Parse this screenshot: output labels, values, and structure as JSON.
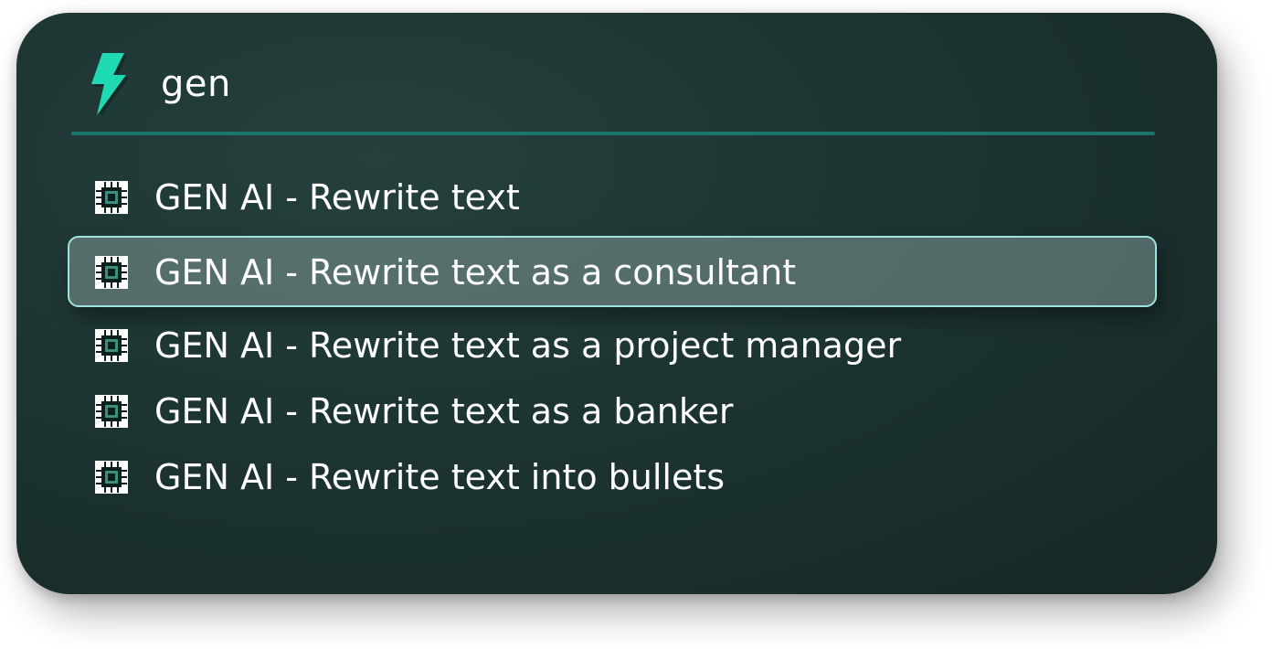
{
  "search": {
    "query": "gen",
    "icon": "lightning-bolt-icon",
    "accent_color": "#1fd9b3"
  },
  "results": [
    {
      "label": "GEN AI - Rewrite text",
      "icon": "chip-icon",
      "selected": false
    },
    {
      "label": "GEN AI - Rewrite text as a consultant",
      "icon": "chip-icon",
      "selected": true
    },
    {
      "label": "GEN AI - Rewrite text as a project manager",
      "icon": "chip-icon",
      "selected": false
    },
    {
      "label": "GEN AI - Rewrite text as a banker",
      "icon": "chip-icon",
      "selected": false
    },
    {
      "label": "GEN AI - Rewrite text into bullets",
      "icon": "chip-icon",
      "selected": false
    }
  ],
  "colors": {
    "panel_background": "#1c3432",
    "divider": "#1b7669",
    "selection_border": "#9fe3e0"
  }
}
